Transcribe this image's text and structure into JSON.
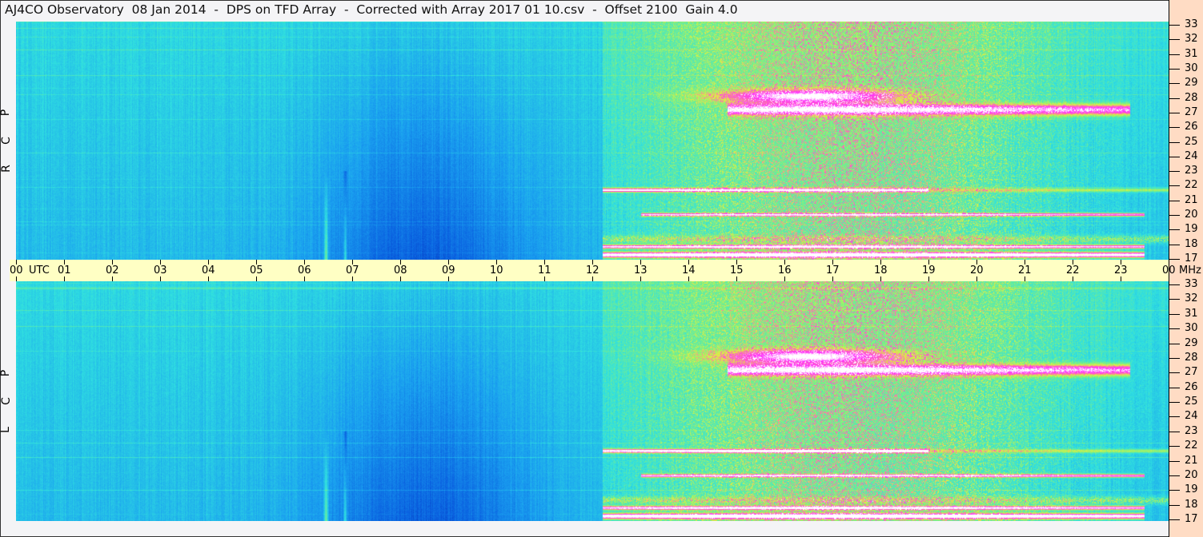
{
  "title": "AJ4CO Observatory  08 Jan 2014  -  DPS on TFD Array  -  Corrected with Array 2017 01 10.csv  -  Offset 2100  Gain 4.0",
  "chart_data": {
    "type": "heatmap",
    "panels": [
      {
        "label": [
          "R",
          "C",
          "P"
        ]
      },
      {
        "label": [
          "L",
          "C",
          "P"
        ]
      }
    ],
    "x_ticks": [
      "00",
      "01",
      "02",
      "03",
      "04",
      "05",
      "06",
      "07",
      "08",
      "09",
      "10",
      "11",
      "12",
      "13",
      "14",
      "15",
      "16",
      "17",
      "18",
      "19",
      "20",
      "21",
      "22",
      "23",
      "00"
    ],
    "x_unit": "UTC",
    "y_ticks": [
      17,
      18,
      19,
      20,
      21,
      22,
      23,
      24,
      25,
      26,
      27,
      28,
      29,
      30,
      31,
      32,
      33
    ],
    "y_unit": "MHz",
    "xlim": [
      0,
      24
    ],
    "ylim": [
      17,
      33
    ],
    "colormap": [
      "#0020a0",
      "#0a60e0",
      "#1aa0f0",
      "#30e0e0",
      "#80f080",
      "#e0f040",
      "#ff60c0",
      "#ff30ff",
      "#ffffff"
    ]
  }
}
